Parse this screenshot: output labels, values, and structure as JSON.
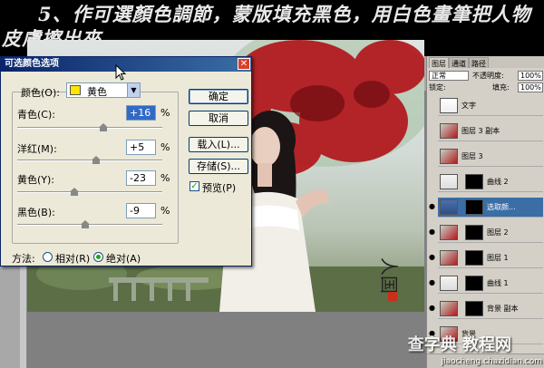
{
  "banner": {
    "text": "5、作可選顏色調節，蒙版填充黑色，用白色畫筆把人物皮膚擦出來"
  },
  "dialog": {
    "title": "可选颜色选项",
    "colors_label": "颜色(O):",
    "colors_value": "黄色",
    "sliders": [
      {
        "label": "青色(C):",
        "value": "+16",
        "position": 0.58
      },
      {
        "label": "洋红(M):",
        "value": "+5",
        "position": 0.53
      },
      {
        "label": "黄色(Y):",
        "value": "-23",
        "position": 0.38
      },
      {
        "label": "黑色(B):",
        "value": "-9",
        "position": 0.45
      }
    ],
    "percent": "%",
    "buttons": {
      "ok": "确定",
      "cancel": "取消",
      "load": "载入(L)...",
      "save": "存储(S)..."
    },
    "preview_label": "预览(P)",
    "preview_checked": true,
    "method_label": "方法:",
    "method_options": [
      "相对(R)",
      "绝对(A)"
    ],
    "method_selected": "绝对(A)"
  },
  "layers_panel": {
    "tabs": [
      "图层",
      "通道",
      "路径"
    ],
    "blend_mode": "正常",
    "opacity_label": "不透明度:",
    "opacity_value": "100%",
    "lock_label": "锁定:",
    "fill_label": "填充:",
    "fill_value": "100%",
    "layers": [
      {
        "name": "文字",
        "visible": false,
        "selected": false,
        "mask": false
      },
      {
        "name": "图层 3 副本",
        "visible": false,
        "selected": false,
        "mask": false
      },
      {
        "name": "图层 3",
        "visible": false,
        "selected": false,
        "mask": false
      },
      {
        "name": "曲线 2",
        "visible": false,
        "selected": false,
        "mask": true
      },
      {
        "name": "选取颜...",
        "visible": true,
        "selected": true,
        "mask": true
      },
      {
        "name": "图层 2",
        "visible": true,
        "selected": false,
        "mask": true
      },
      {
        "name": "图层 1",
        "visible": true,
        "selected": false,
        "mask": true
      },
      {
        "name": "曲线 1",
        "visible": true,
        "selected": false,
        "mask": true
      },
      {
        "name": "背景 副本",
        "visible": true,
        "selected": false,
        "mask": true
      },
      {
        "name": "背景",
        "visible": true,
        "selected": false,
        "mask": false
      }
    ]
  },
  "watermark": {
    "main": "查字典 教程网",
    "sub": "jiaocheng.chazidian.com"
  },
  "colors": {
    "titlebar": "#0a246a",
    "dialog_bg": "#ece9d8",
    "swatch": "#ffe600",
    "selected_layer": "#3a6ea5"
  }
}
